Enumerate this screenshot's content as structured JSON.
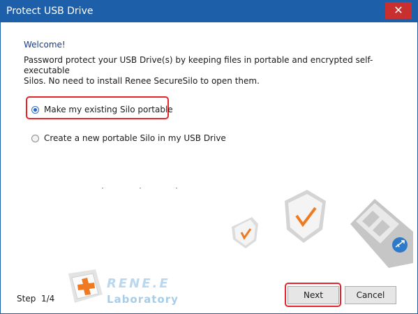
{
  "window": {
    "title": "Protect USB Drive",
    "close_icon": "close-icon",
    "title_bar_color": "#1d5fa8"
  },
  "content": {
    "welcome": "Welcome!",
    "description_line1": "Password protect your USB Drive(s) by keeping files in portable and encrypted self-executable",
    "description_line2": "Silos. No need to install Renee SecureSilo to open them."
  },
  "options": [
    {
      "label": "Make my existing Silo portable",
      "selected": true
    },
    {
      "label": "Create a new portable Silo in my USB Drive",
      "selected": false
    }
  ],
  "footer": {
    "step_label": "Step",
    "step_value": "1/4",
    "logo_line1": "RENE.E",
    "logo_line2": "Laboratory",
    "next_label": "Next",
    "cancel_label": "Cancel"
  },
  "colors": {
    "highlight": "#e5232a",
    "accent_orange": "#f07a22",
    "welcome_text": "#17398b"
  }
}
